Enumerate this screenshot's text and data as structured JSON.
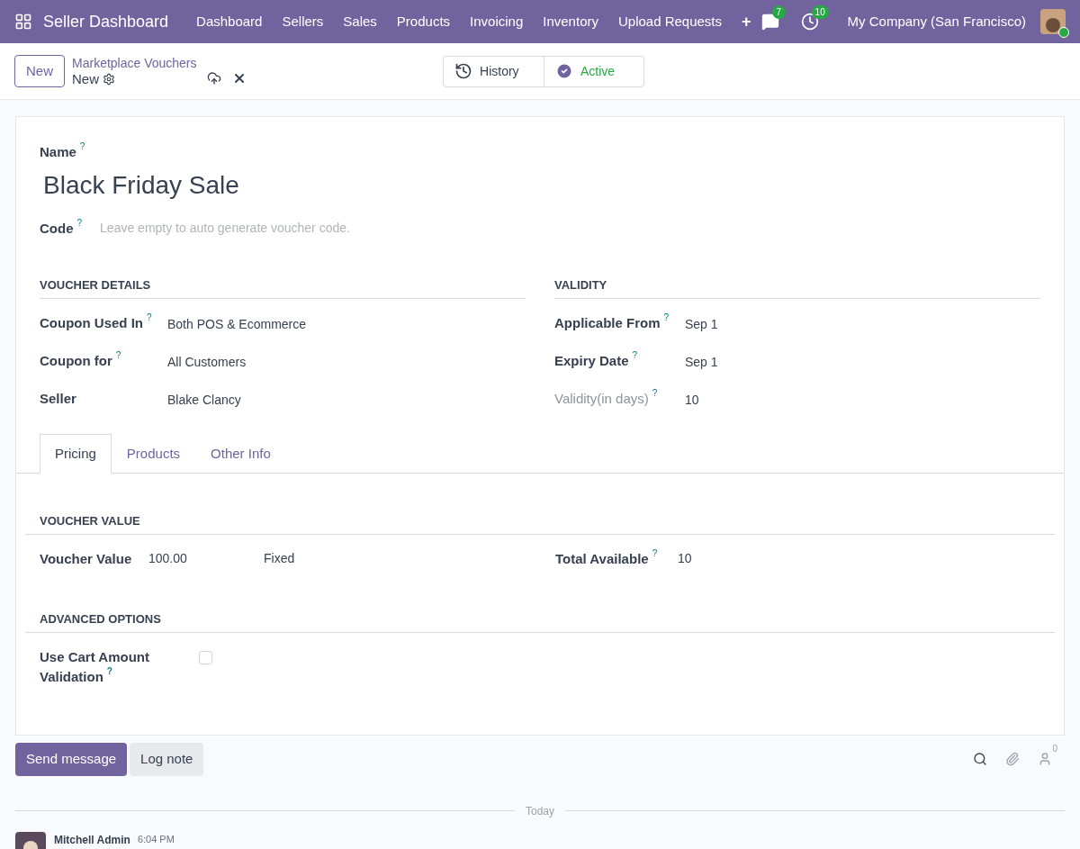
{
  "navbar": {
    "app_title": "Seller Dashboard",
    "menu": [
      "Dashboard",
      "Sellers",
      "Sales",
      "Products",
      "Invoicing",
      "Inventory",
      "Upload Requests",
      "+"
    ],
    "messages_count": "7",
    "activities_count": "10",
    "company": "My Company (San Francisco)"
  },
  "control_panel": {
    "new_button": "New",
    "breadcrumb": "Marketplace Vouchers",
    "record": "New",
    "history": "History",
    "status": "Active"
  },
  "form": {
    "name_label": "Name",
    "name_help": "?",
    "name_value": "Black Friday Sale",
    "code_label": "Code",
    "code_help": "?",
    "code_placeholder": "Leave empty to auto generate voucher code.",
    "groups": [
      {
        "title": "VOUCHER DETAILS",
        "fields": [
          {
            "label": "Coupon Used In",
            "help": "?",
            "value": "Both POS & Ecommerce",
            "muted": false
          },
          {
            "label": "Coupon for",
            "help": "?",
            "value": "All Customers",
            "muted": false
          },
          {
            "label": "Seller",
            "value": "Blake Clancy",
            "muted": false
          }
        ]
      },
      {
        "title": "VALIDITY",
        "fields": [
          {
            "label": "Applicable From",
            "help": "?",
            "value": "Sep 1",
            "muted": false
          },
          {
            "label": "Expiry Date",
            "help": "?",
            "value": "Sep 1",
            "muted": false
          },
          {
            "label": "Validity(in days)",
            "help": "?",
            "value": "10",
            "muted": true
          }
        ]
      }
    ],
    "tabs": [
      {
        "label": "Pricing",
        "selected": true
      },
      {
        "label": "Products",
        "selected": false
      },
      {
        "label": "Other Info",
        "selected": false
      }
    ],
    "voucher_value_section": {
      "title": "VOUCHER VALUE",
      "value_label": "Voucher Value",
      "value": "100.00",
      "value_type": "Fixed",
      "total_label": "Total Available",
      "total_help": "?",
      "total": "10"
    },
    "advanced_section": {
      "title": "ADVANCED OPTIONS",
      "label_line1": "Use Cart Amount",
      "label_line2": "Validation",
      "help": "?",
      "checked": false
    }
  },
  "chatter": {
    "send_message": "Send message",
    "log_note": "Log note",
    "followers_count": "0",
    "separator": "Today",
    "message": {
      "author": "Mitchell Admin",
      "time": "6:04 PM"
    }
  }
}
